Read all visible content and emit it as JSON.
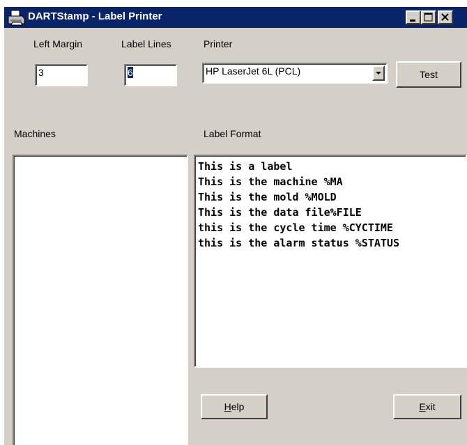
{
  "window": {
    "title": "DARTStamp - Label Printer",
    "icon": "printer-icon",
    "controls": [
      "minimize-icon",
      "maximize-icon",
      "close-icon"
    ]
  },
  "settings": {
    "left_margin_label": "Left Margin",
    "left_margin_value": "3",
    "label_lines_label": "Label Lines",
    "label_lines_value": "6",
    "printer_label": "Printer",
    "printer_value": "HP LaserJet 6L (PCL)",
    "test_button": "Test"
  },
  "machines": {
    "label": "Machines",
    "items": []
  },
  "label_format": {
    "label": "Label Format",
    "lines": [
      "This is a label",
      "This is the machine %MA",
      "This is the mold %MOLD",
      "This is the data file%FILE",
      "this is the cycle time %CYCTIME",
      "this is the alarm status %STATUS"
    ]
  },
  "buttons": {
    "help_mnemonic": "H",
    "help_rest": "elp",
    "exit_mnemonic": "E",
    "exit_rest": "xit"
  },
  "colors": {
    "titlebar": "#0a246a",
    "face": "#d4d0c8"
  }
}
